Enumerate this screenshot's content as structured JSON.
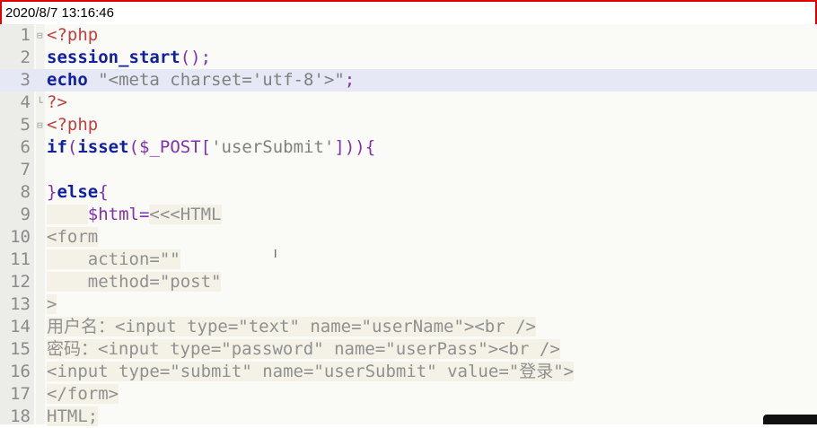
{
  "timestamp": "2020/8/7 13:16:46",
  "lines": [
    {
      "n": "1",
      "parts": [
        [
          "php",
          "<?php"
        ]
      ],
      "fold": "⊟"
    },
    {
      "n": "2",
      "parts": [
        [
          "kw",
          "session_start"
        ],
        [
          "pun",
          "();"
        ]
      ]
    },
    {
      "n": "3",
      "parts": [
        [
          "kw",
          "echo"
        ],
        [
          "plain",
          " "
        ],
        [
          "str",
          "\"<meta charset='utf-8'>\""
        ],
        [
          "pun",
          ";"
        ]
      ],
      "active": true
    },
    {
      "n": "4",
      "parts": [
        [
          "php",
          "?>"
        ]
      ],
      "fold": "└"
    },
    {
      "n": "5",
      "parts": [
        [
          "php",
          "<?php"
        ]
      ],
      "fold": "⊟"
    },
    {
      "n": "6",
      "parts": [
        [
          "kw",
          "if"
        ],
        [
          "pun",
          "("
        ],
        [
          "kw",
          "isset"
        ],
        [
          "pun",
          "("
        ],
        [
          "var",
          "$_POST"
        ],
        [
          "pun",
          "["
        ],
        [
          "str",
          "'userSubmit'"
        ],
        [
          "pun",
          "])){"
        ]
      ]
    },
    {
      "n": "7",
      "parts": []
    },
    {
      "n": "8",
      "parts": [
        [
          "pun",
          "}"
        ],
        [
          "kw",
          "else"
        ],
        [
          "pun",
          "{"
        ]
      ]
    },
    {
      "n": "9",
      "parts": [
        [
          "plain",
          "    "
        ],
        [
          "var",
          "$html"
        ],
        [
          "pun",
          "="
        ],
        [
          "plain",
          "<<<HTML"
        ]
      ]
    },
    {
      "n": "10",
      "parts": [
        [
          "plain",
          "<form"
        ]
      ]
    },
    {
      "n": "11",
      "parts": [
        [
          "plain",
          "    action=\"\""
        ]
      ]
    },
    {
      "n": "12",
      "parts": [
        [
          "plain",
          "    method=\"post\""
        ]
      ]
    },
    {
      "n": "13",
      "parts": [
        [
          "plain",
          ">"
        ]
      ]
    },
    {
      "n": "14",
      "parts": [
        [
          "plain",
          "用户名：<input type=\"text\" name=\"userName\"><br />"
        ]
      ]
    },
    {
      "n": "15",
      "parts": [
        [
          "plain",
          "密码：<input type=\"password\" name=\"userPass\"><br />"
        ]
      ]
    },
    {
      "n": "16",
      "parts": [
        [
          "plain",
          "<input type=\"submit\" name=\"userSubmit\" value=\"登录\">"
        ]
      ]
    },
    {
      "n": "17",
      "parts": [
        [
          "plain",
          "</form>"
        ]
      ]
    },
    {
      "n": "18",
      "parts": [
        [
          "plain",
          "HTML;"
        ]
      ]
    }
  ],
  "colors": {
    "php": "#c04040",
    "keyword": "#1020a0",
    "punct": "#8030b0",
    "string": "#808080",
    "border": "#e00000"
  }
}
